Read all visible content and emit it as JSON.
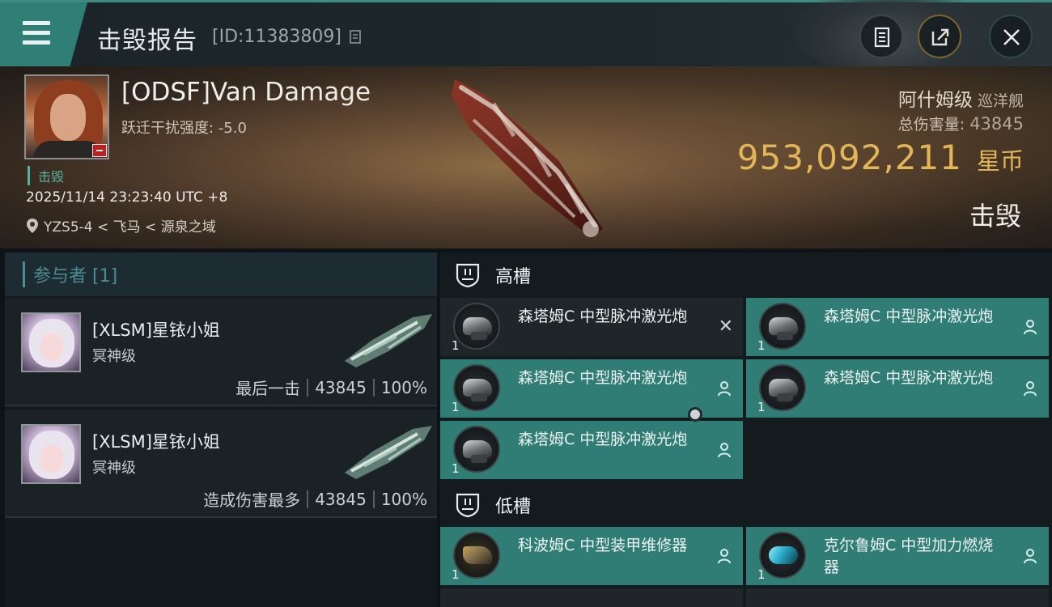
{
  "header": {
    "title": "击毁报告",
    "report_id": "[ID:11383809]",
    "icons": [
      "menu-icon",
      "copy-icon",
      "clipboard-icon",
      "share-icon",
      "close-icon"
    ]
  },
  "victim": {
    "name": "[ODSF]Van Damage",
    "warp_label": "跃迁干扰强度:",
    "warp_value": "-5.0",
    "tag": "击毁",
    "time": "2025/11/14 23:23:40 UTC +8",
    "location": "YZS5-4 < 飞马 < 源泉之域",
    "ship_name": "阿什姆级",
    "ship_class": "巡洋舰",
    "total_damage_label": "总伤害量:",
    "total_damage": "43845",
    "isk_value": "953,092,211",
    "isk_unit": "星币",
    "result": "击毁"
  },
  "participants": {
    "header": "参与者 [1]",
    "items": [
      {
        "name": "[XLSM]星铱小姐",
        "ship": "冥神级",
        "role": "最后一击",
        "damage": "43845",
        "percent": "100%"
      },
      {
        "name": "[XLSM]星铱小姐",
        "ship": "冥神级",
        "role": "造成伤害最多",
        "damage": "43845",
        "percent": "100%"
      }
    ]
  },
  "fitting": {
    "high_slot_label": "高槽",
    "low_slot_label": "低槽",
    "high_modules": [
      {
        "name": "森塔姆C 中型脉冲激光炮",
        "qty": "1",
        "status": "destroyed"
      },
      {
        "name": "森塔姆C 中型脉冲激光炮",
        "qty": "1",
        "status": "dropped"
      },
      {
        "name": "森塔姆C 中型脉冲激光炮",
        "qty": "1",
        "status": "dropped"
      },
      {
        "name": "森塔姆C 中型脉冲激光炮",
        "qty": "1",
        "status": "dropped"
      },
      {
        "name": "森塔姆C 中型脉冲激光炮",
        "qty": "1",
        "status": "dropped"
      }
    ],
    "low_modules": [
      {
        "name": "科波姆C 中型装甲维修器",
        "qty": "1",
        "status": "dropped"
      },
      {
        "name": "克尔鲁姆C 中型加力燃烧器",
        "qty": "1",
        "status": "dropped"
      }
    ]
  },
  "colors": {
    "accent_teal": "#2f7d75",
    "isk_gold": "#f0c25a",
    "destroyed_row": "#1f2528"
  }
}
